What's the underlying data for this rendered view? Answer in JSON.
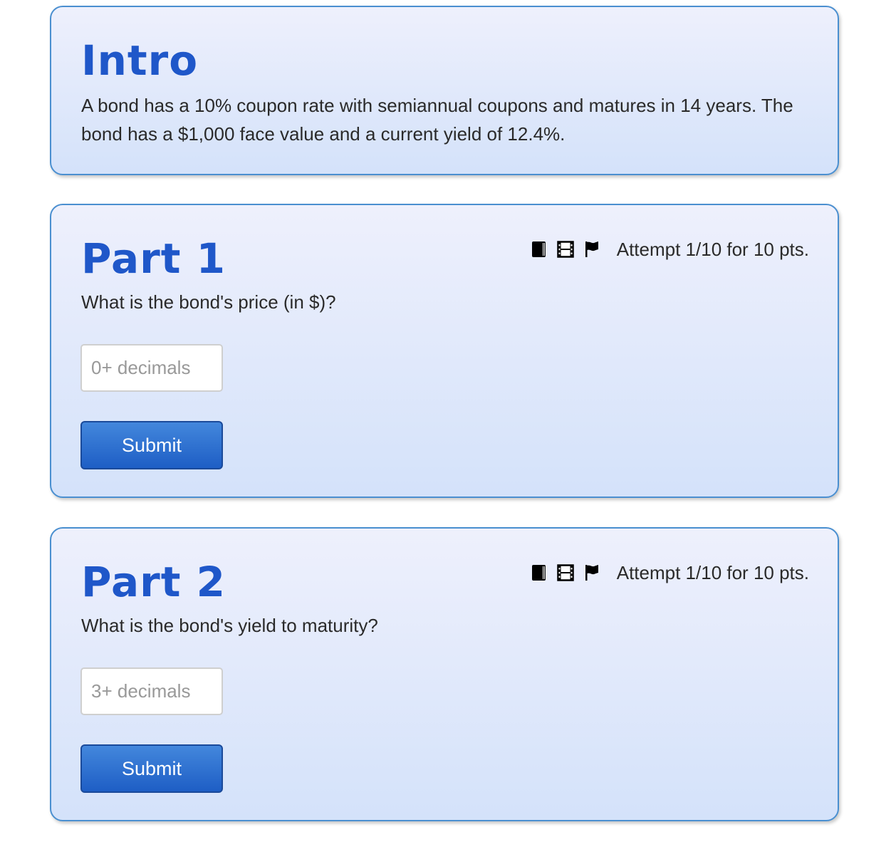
{
  "intro": {
    "title": "Intro",
    "text": "A bond has a 10% coupon rate with semiannual coupons and matures in 14 years. The bond has a $1,000 face value and a current yield of 12.4%."
  },
  "parts": [
    {
      "title": "Part 1",
      "question": "What is the bond's price (in $)?",
      "input_placeholder": "0+ decimals",
      "submit_label": "Submit",
      "attempt_text": "Attempt 1/10 for 10 pts.",
      "icons": [
        "book-icon",
        "film-icon",
        "flag-icon"
      ]
    },
    {
      "title": "Part 2",
      "question": "What is the bond's yield to maturity?",
      "input_placeholder": "3+ decimals",
      "submit_label": "Submit",
      "attempt_text": "Attempt 1/10 for 10 pts.",
      "icons": [
        "book-icon",
        "film-icon",
        "flag-icon"
      ]
    }
  ],
  "colors": {
    "title": "#1f57c9",
    "card_border": "#4a8fd0",
    "button": "#1e5ec5"
  }
}
